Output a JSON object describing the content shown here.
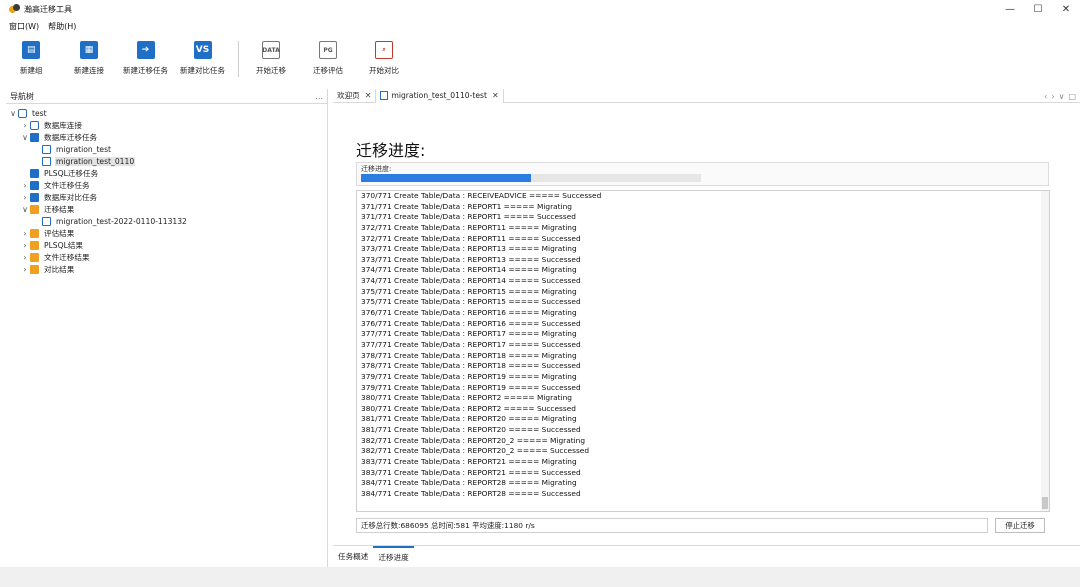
{
  "window": {
    "title": "瀚高迁移工具",
    "controls": {
      "minimize": "—",
      "maximize": "☐",
      "close": "✕"
    }
  },
  "menu": {
    "items": [
      "窗口(W)",
      "帮助(H)"
    ]
  },
  "toolbar": {
    "buttons": [
      {
        "label": "新建组",
        "icon": "new-group-icon"
      },
      {
        "label": "新建连接",
        "icon": "new-connection-icon"
      },
      {
        "label": "新建迁移任务",
        "icon": "new-migration-task-icon"
      },
      {
        "label": "新建对比任务",
        "icon": "vs-icon",
        "icon_text": "VS"
      },
      {
        "label": "开始迁移",
        "icon": "start-migration-icon",
        "icon_text": "DATA"
      },
      {
        "label": "迁移评估",
        "icon": "migration-assessment-icon",
        "icon_text": "PG"
      },
      {
        "label": "开始对比",
        "icon": "start-compare-icon"
      }
    ]
  },
  "nav": {
    "title": "导航树",
    "more": "...",
    "tree": [
      {
        "label": "test",
        "chev": "∨",
        "icon": "db"
      },
      {
        "label": "数据库连接",
        "chev": "›",
        "icon": "db"
      },
      {
        "label": "数据库迁移任务",
        "chev": "∨",
        "icon": "blue"
      },
      {
        "label": "migration_test",
        "chev": "",
        "icon": "doc"
      },
      {
        "label": "migration_test_0110",
        "chev": "",
        "icon": "doc",
        "selected": true
      },
      {
        "label": "PLSQL迁移任务",
        "chev": "",
        "icon": "blue"
      },
      {
        "label": "文件迁移任务",
        "chev": "›",
        "icon": "blue"
      },
      {
        "label": "数据库对比任务",
        "chev": "›",
        "icon": "vs"
      },
      {
        "label": "迁移结果",
        "chev": "∨",
        "icon": "folder"
      },
      {
        "label": "migration_test-2022-0110-113132",
        "chev": "",
        "icon": "doc"
      },
      {
        "label": "评估结果",
        "chev": "›",
        "icon": "folder"
      },
      {
        "label": "PLSQL结果",
        "chev": "›",
        "icon": "folder"
      },
      {
        "label": "文件迁移结果",
        "chev": "›",
        "icon": "folder"
      },
      {
        "label": "对比结果",
        "chev": "›",
        "icon": "folder"
      }
    ]
  },
  "tabs": {
    "items": [
      {
        "label": "欢迎页",
        "close": "✕"
      },
      {
        "label": "migration_test_0110-test",
        "close": "✕",
        "active": true
      }
    ],
    "nav": [
      "‹",
      "›",
      "∨",
      "□"
    ]
  },
  "migration": {
    "title": "迁移进度:",
    "progress_label": "迁移进度:",
    "progress_fraction": 0.5,
    "log": [
      "370/771 Create Table/Data : RECEIVEADVICE ===== Successed",
      "371/771 Create Table/Data : REPORT1 ===== Migrating",
      "371/771 Create Table/Data : REPORT1 ===== Successed",
      "372/771 Create Table/Data : REPORT11 ===== Migrating",
      "372/771 Create Table/Data : REPORT11 ===== Successed",
      "373/771 Create Table/Data : REPORT13 ===== Migrating",
      "373/771 Create Table/Data : REPORT13 ===== Successed",
      "374/771 Create Table/Data : REPORT14 ===== Migrating",
      "374/771 Create Table/Data : REPORT14 ===== Successed",
      "375/771 Create Table/Data : REPORT15 ===== Migrating",
      "375/771 Create Table/Data : REPORT15 ===== Successed",
      "376/771 Create Table/Data : REPORT16 ===== Migrating",
      "376/771 Create Table/Data : REPORT16 ===== Successed",
      "377/771 Create Table/Data : REPORT17 ===== Migrating",
      "377/771 Create Table/Data : REPORT17 ===== Successed",
      "378/771 Create Table/Data : REPORT18 ===== Migrating",
      "378/771 Create Table/Data : REPORT18 ===== Successed",
      "379/771 Create Table/Data : REPORT19 ===== Migrating",
      "379/771 Create Table/Data : REPORT19 ===== Successed",
      "380/771 Create Table/Data : REPORT2 ===== Migrating",
      "380/771 Create Table/Data : REPORT2 ===== Successed",
      "381/771 Create Table/Data : REPORT20 ===== Migrating",
      "381/771 Create Table/Data : REPORT20 ===== Successed",
      "382/771 Create Table/Data : REPORT20_2 ===== Migrating",
      "382/771 Create Table/Data : REPORT20_2 ===== Successed",
      "383/771 Create Table/Data : REPORT21 ===== Migrating",
      "383/771 Create Table/Data : REPORT21 ===== Successed",
      "384/771 Create Table/Data : REPORT28 ===== Migrating",
      "384/771 Create Table/Data : REPORT28 ===== Successed"
    ],
    "stats": "迁移总行数:686095  总时间:581  平均速度:1180 r/s",
    "stop_button": "停止迁移"
  },
  "bottom_tabs": [
    {
      "label": "任务概述"
    },
    {
      "label": "迁移进度",
      "active": true
    }
  ],
  "colors": {
    "accent": "#1e6fc5",
    "progress": "#2a7de1",
    "folder": "#f0a020"
  }
}
